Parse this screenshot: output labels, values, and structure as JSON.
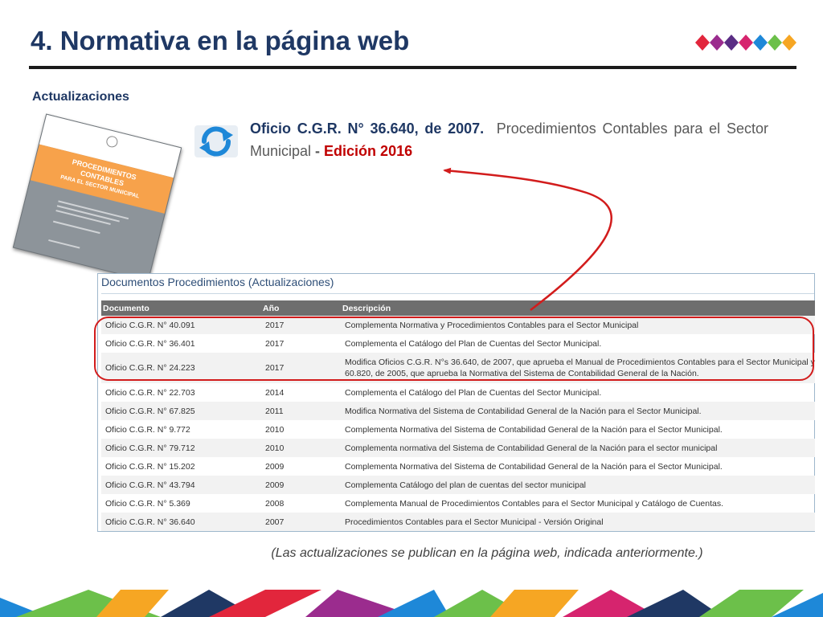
{
  "slide": {
    "title": "4. Normativa en la página web",
    "subtitle": "Actualizaciones"
  },
  "book": {
    "band_lines": [
      "PROCEDIMIENTOS",
      "CONTABLES",
      "PARA EL SECTOR MUNICIPAL"
    ]
  },
  "oficio": {
    "lead": "Oficio C.G.R. N° 36.640, de 2007.",
    "body": "Procedimientos Contables para el Sector Municipal",
    "dash": " - ",
    "edition": "Edición 2016"
  },
  "docs": {
    "heading": "Documentos Procedimientos (Actualizaciones)",
    "columns": [
      "Documento",
      "Año",
      "Descripción"
    ],
    "rows": [
      {
        "documento": "Oficio C.G.R. N° 40.091",
        "anio": "2017",
        "descripcion": "Complementa Normativa y Procedimientos Contables para el Sector Municipal"
      },
      {
        "documento": "Oficio C.G.R. N° 36.401",
        "anio": "2017",
        "descripcion": "Complementa el Catálogo del Plan de Cuentas del Sector Municipal."
      },
      {
        "documento": "Oficio C.G.R. N° 24.223",
        "anio": "2017",
        "descripcion": "Modifica Oficios C.G.R. N°s 36.640, de 2007, que aprueba el Manual de Procedimientos Contables para el Sector Municipal y 60.820, de 2005, que aprueba la Normativa del Sistema de Contabilidad General de la Nación."
      },
      {
        "documento": "Oficio C.G.R. N° 22.703",
        "anio": "2014",
        "descripcion": "Complementa el Catálogo del Plan de Cuentas del Sector Municipal."
      },
      {
        "documento": "Oficio C.G.R. N° 67.825",
        "anio": "2011",
        "descripcion": "Modifica Normativa del Sistema de Contabilidad General de la Nación para el Sector Municipal."
      },
      {
        "documento": "Oficio C.G.R. N° 9.772",
        "anio": "2010",
        "descripcion": "Complementa Normativa del Sistema de Contabilidad General de la Nación para el Sector Municipal."
      },
      {
        "documento": "Oficio C.G.R. N° 79.712",
        "anio": "2010",
        "descripcion": "Complementa normativa del Sistema de Contabilidad General de la Nación para el sector municipal"
      },
      {
        "documento": "Oficio C.G.R. N° 15.202",
        "anio": "2009",
        "descripcion": "Complementa Normativa del Sistema de Contabilidad General de la Nación para el Sector Municipal."
      },
      {
        "documento": "Oficio C.G.R. N° 43.794",
        "anio": "2009",
        "descripcion": "Complementa Catálogo del plan de cuentas del sector municipal"
      },
      {
        "documento": "Oficio C.G.R. N° 5.369",
        "anio": "2008",
        "descripcion": "Complementa Manual de Procedimientos Contables para el Sector Municipal y Catálogo de Cuentas."
      },
      {
        "documento": "Oficio C.G.R. N° 36.640",
        "anio": "2007",
        "descripcion": "Procedimientos Contables para el Sector Municipal - Versión Original"
      }
    ]
  },
  "footnote": "(Las actualizaciones se publican en la página web, indicada anteriormente.)",
  "colors": {
    "title_blue": "#1f3864",
    "edition_red": "#c00000",
    "highlight_red": "#d21c1c",
    "table_header_grey": "#6e6e6e",
    "sync_icon_blue": "#1e88d8",
    "diamond_palette": [
      "#e2263c",
      "#9b2c8e",
      "#5a2d84",
      "#d6246e",
      "#1e88d8",
      "#6cc04a",
      "#f6a623"
    ]
  },
  "icons": {
    "sync": "refresh-arrows-icon",
    "decoration": "diamond-row-icon"
  }
}
